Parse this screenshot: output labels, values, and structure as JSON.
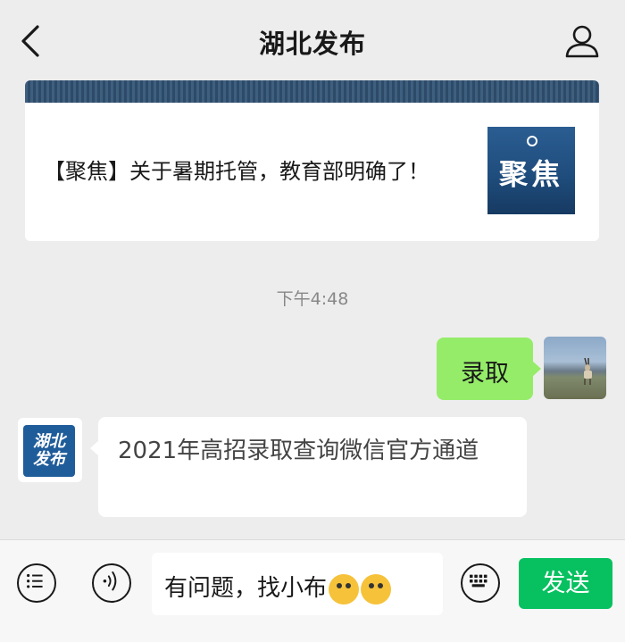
{
  "header": {
    "title": "湖北发布"
  },
  "article": {
    "text": "【聚焦】关于暑期托管，教育部明确了！",
    "thumb_text": "聚焦"
  },
  "chat": {
    "timestamp": "下午4:48",
    "outgoing": {
      "text": "录取"
    },
    "incoming": {
      "avatar_line1": "湖北",
      "avatar_line2": "发布",
      "text": "2021年高招录取查询微信官方通道"
    }
  },
  "input": {
    "text": "有问题，找小布"
  },
  "toolbar": {
    "send_label": "发送"
  },
  "colors": {
    "accent": "#07c160",
    "bubble_out": "#95ec69",
    "background": "#ededed"
  },
  "icons": [
    "back-icon",
    "profile-icon",
    "menu-icon",
    "voice-icon",
    "keyboard-icon",
    "emoji-icon"
  ]
}
